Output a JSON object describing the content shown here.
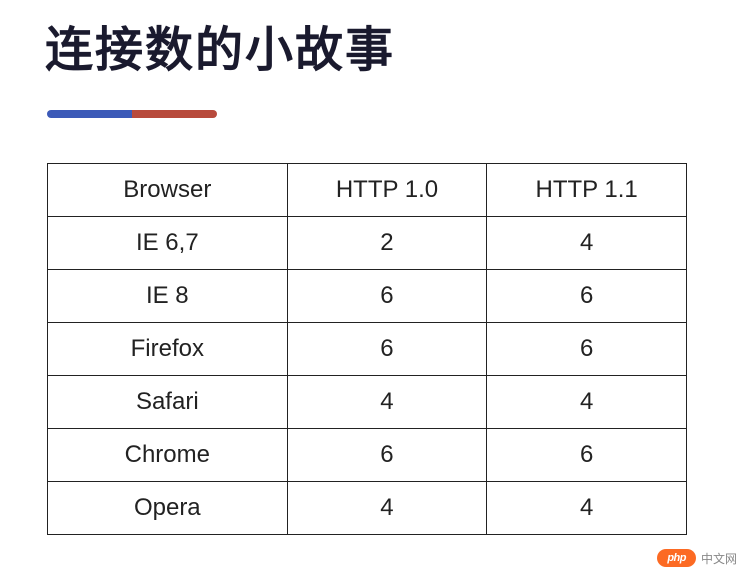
{
  "title": "连接数的小故事",
  "table": {
    "headers": [
      "Browser",
      "HTTP 1.0",
      "HTTP 1.1"
    ],
    "rows": [
      {
        "browser": "IE 6,7",
        "http10": "2",
        "http11": "4"
      },
      {
        "browser": "IE 8",
        "http10": "6",
        "http11": "6"
      },
      {
        "browser": "Firefox",
        "http10": "6",
        "http11": "6"
      },
      {
        "browser": "Safari",
        "http10": "4",
        "http11": "4"
      },
      {
        "browser": "Chrome",
        "http10": "6",
        "http11": "6"
      },
      {
        "browser": "Opera",
        "http10": "4",
        "http11": "4"
      }
    ]
  },
  "watermark": {
    "badge": "php",
    "text": "中文网"
  },
  "chart_data": {
    "type": "table",
    "title": "连接数的小故事",
    "columns": [
      "Browser",
      "HTTP 1.0",
      "HTTP 1.1"
    ],
    "rows": [
      [
        "IE 6,7",
        2,
        4
      ],
      [
        "IE 8",
        6,
        6
      ],
      [
        "Firefox",
        6,
        6
      ],
      [
        "Safari",
        4,
        4
      ],
      [
        "Chrome",
        6,
        6
      ],
      [
        "Opera",
        4,
        4
      ]
    ]
  }
}
